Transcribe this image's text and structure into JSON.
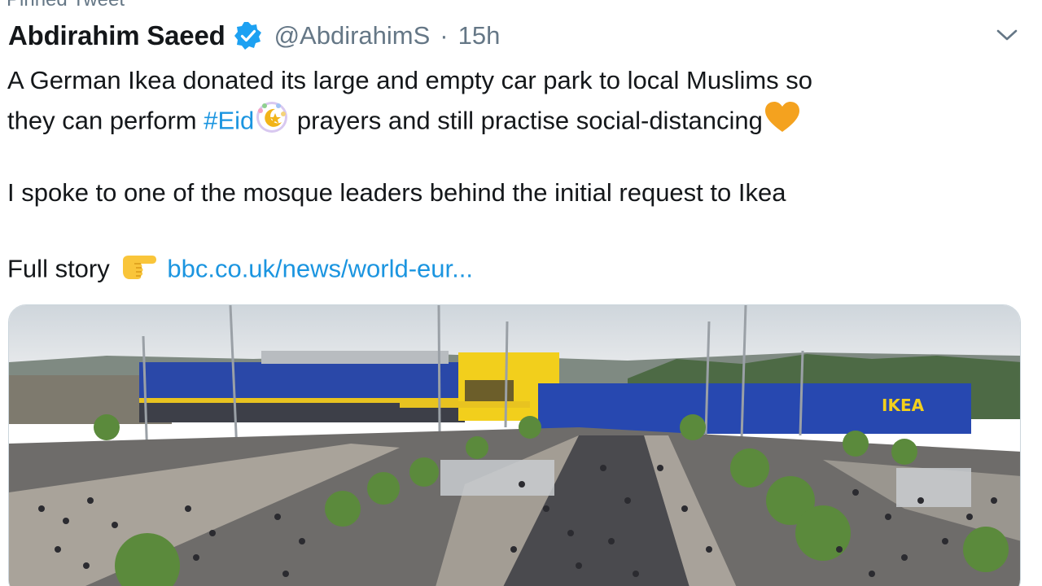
{
  "tweet": {
    "pinned_label": "Pinned Tweet",
    "author": {
      "display_name": "Abdirahim Saeed",
      "handle": "@AbdirahimS",
      "separator": "·",
      "timestamp": "15h",
      "verified": true
    },
    "text": {
      "line1": "A German Ikea donated its large and empty car park to local Muslims so",
      "line2_a": "they can perform ",
      "hashtag": "#Eid",
      "line2_b": " prayers and still practise social-distancing",
      "line3": "I spoke to one of the mosque leaders behind the initial request to Ikea",
      "line4_a": "Full story ",
      "link": "bbc.co.uk/news/world-eur..."
    },
    "emojis": [
      "crescent-star-emoji",
      "orange-heart-emoji",
      "pointing-right-emoji"
    ],
    "media": {
      "sign_text": "IKEA",
      "colors": {
        "store_blue": "#2a48a8",
        "store_yellow": "#f2cf1c",
        "sky": "#dde2e6"
      }
    }
  },
  "colors": {
    "link": "#1b95e0",
    "muted": "#657786",
    "text": "#14171a",
    "verified": "#1da1f2"
  }
}
